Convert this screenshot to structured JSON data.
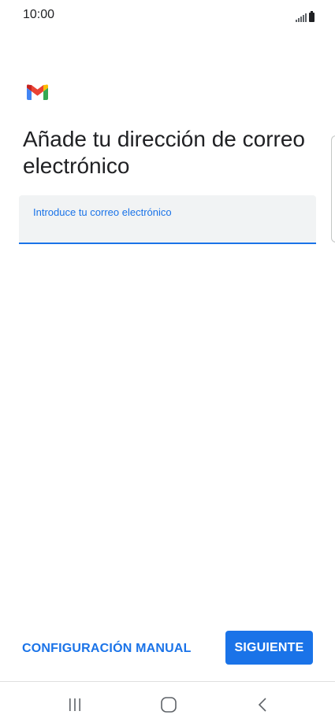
{
  "status_bar": {
    "time": "10:00",
    "icons": [
      "signal-icon",
      "battery-icon"
    ]
  },
  "logo": {
    "name": "gmail-logo",
    "colors": [
      "#4285F4",
      "#EA4335",
      "#FBBC04",
      "#34A853",
      "#C5221F"
    ]
  },
  "page": {
    "title": "Añade tu dirección de correo electrónico"
  },
  "email_field": {
    "label": "Introduce tu correo electrónico",
    "value": ""
  },
  "actions": {
    "manual_label": "CONFIGURACIÓN MANUAL",
    "next_label": "SIGUIENTE"
  },
  "nav_bar": {
    "icons": [
      "recents-icon",
      "home-icon",
      "back-icon"
    ]
  },
  "colors": {
    "accent": "#1a73e8",
    "field_background": "#f1f3f4",
    "text": "#202124"
  }
}
